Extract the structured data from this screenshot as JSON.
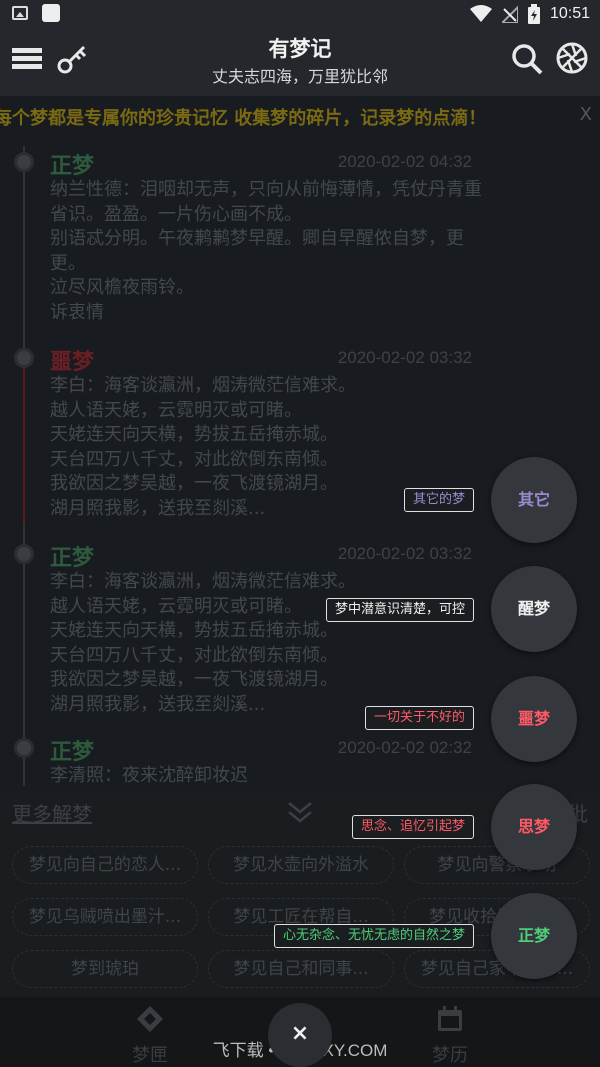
{
  "status_bar": {
    "time": "10:51",
    "icons": [
      "image-icon",
      "app-square-icon",
      "wifi-icon",
      "no-signal-icon",
      "battery-icon"
    ]
  },
  "app_bar": {
    "title": "有梦记",
    "subtitle": "丈夫志四海，万里犹比邻",
    "icons": [
      "menu-icon",
      "key-icon",
      "search-icon",
      "aperture-icon"
    ]
  },
  "marquee": {
    "text": "每个梦都是专属你的珍贵记忆 收集梦的碎片，记录梦的点滴！",
    "close": "X"
  },
  "entries": [
    {
      "type": "正梦",
      "date": "2020-02-02 04:32",
      "lines": [
        "纳兰性德：泪咽却无声，只向从前悔薄情，凭仗丹青重",
        "省识。盈盈。一片伤心画不成。",
        "别语忒分明。午夜鹣鹣梦早醒。卿自早醒侬自梦，更",
        "更。",
        "泣尽风檐夜雨铃。",
        "诉衷情"
      ]
    },
    {
      "type": "噩梦",
      "date": "2020-02-02 03:32",
      "lines": [
        "李白：海客谈瀛洲，烟涛微茫信难求。",
        "越人语天姥，云霓明灭或可睹。",
        "天姥连天向天横，势拔五岳掩赤城。",
        "天台四万八千丈，对此欲倒东南倾。",
        "我欲因之梦吴越，一夜飞渡镜湖月。",
        "湖月照我影，送我至剡溪..."
      ]
    },
    {
      "type": "正梦",
      "date": "2020-02-02 03:32",
      "lines": [
        "李白：海客谈瀛洲，烟涛微茫信难求。",
        "越人语天姥，云霓明灭或可睹。",
        "天姥连天向天横，势拔五岳掩赤城。",
        "天台四万八千丈，对此欲倒东南倾。",
        "我欲因之梦吴越，一夜飞渡镜湖月。",
        "湖月照我影，送我至剡溪..."
      ]
    },
    {
      "type": "正梦",
      "date": "2020-02-02 02:32",
      "lines": [
        "李清照：夜来沈醉卸妆迟"
      ]
    }
  ],
  "more_dreams": {
    "heading": "更多解梦",
    "swap": "换一批",
    "items": [
      "梦见向自己的恋人...",
      "梦见水壶向外溢水",
      "梦见向警察求助",
      "梦见乌贼喷出墨汁...",
      "梦见工匠在帮自...",
      "梦见收拾旧的内裤",
      "梦到琥珀",
      "梦见自己和同事...",
      "梦见自己家中有个..."
    ]
  },
  "fab_menu": [
    {
      "label": "其它",
      "desc": "其它的梦",
      "color": "#9a8ad0"
    },
    {
      "label": "醒梦",
      "desc": "梦中潜意识清楚，可控",
      "color": "#f0f0f0"
    },
    {
      "label": "噩梦",
      "desc": "一切关于不好的",
      "color": "#ff5a66"
    },
    {
      "label": "思梦",
      "desc": "思念、追忆引起梦",
      "color": "#ff5a66"
    },
    {
      "label": "正梦",
      "desc": "心无杂念、无忧无虑的自然之梦",
      "color": "#4fcf7a"
    }
  ],
  "fab_main": {
    "label": "×"
  },
  "bottom_nav": [
    {
      "label": "梦匣",
      "icon": "diamond-icon"
    },
    {
      "label": "梦历",
      "icon": "calendar-icon"
    }
  ],
  "watermark": "飞下载 • BYFZXY.COM"
}
